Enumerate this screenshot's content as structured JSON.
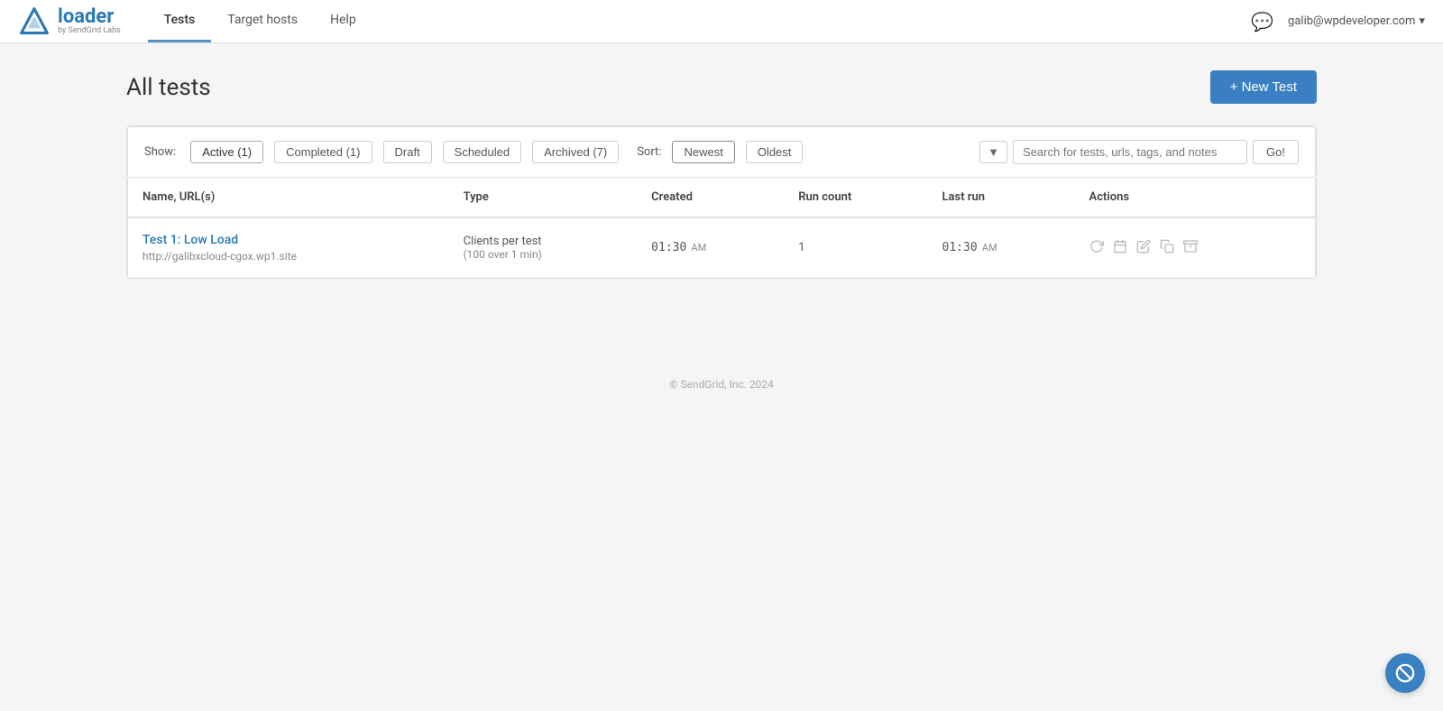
{
  "brand": {
    "name": "loader",
    "sub": "by SendGrid Labs",
    "icon_unicode": "△"
  },
  "nav": {
    "links": [
      {
        "label": "Tests",
        "active": true
      },
      {
        "label": "Target hosts",
        "active": false
      },
      {
        "label": "Help",
        "active": false
      }
    ],
    "user_email": "galib@wpdeveloper.com",
    "user_dropdown_icon": "▾",
    "chat_icon": "💬"
  },
  "page": {
    "title": "All tests",
    "new_test_label": "+ New Test"
  },
  "filter_bar": {
    "show_label": "Show:",
    "filters": [
      {
        "label": "Active (1)",
        "active": true
      },
      {
        "label": "Completed (1)",
        "active": false
      },
      {
        "label": "Draft",
        "active": false
      },
      {
        "label": "Scheduled",
        "active": false
      },
      {
        "label": "Archived (7)",
        "active": false
      }
    ],
    "sort_label": "Sort:",
    "sort_options": [
      {
        "label": "Newest",
        "active": true
      },
      {
        "label": "Oldest",
        "active": false
      }
    ],
    "search_placeholder": "Search for tests, urls, tags, and notes",
    "go_label": "Go!",
    "filter_icon": "▼"
  },
  "table": {
    "columns": [
      {
        "label": "Name, URL(s)"
      },
      {
        "label": "Type"
      },
      {
        "label": "Created"
      },
      {
        "label": "Run count"
      },
      {
        "label": "Last run"
      },
      {
        "label": "Actions"
      }
    ],
    "rows": [
      {
        "name": "Test 1: Low Load",
        "url": "http://galibxcloud-cgox.wp1.site",
        "type_line1": "Clients per test",
        "type_line2": "(100 over 1 min)",
        "created_time": "01:30",
        "created_ampm": "AM",
        "run_count": "1",
        "last_run_time": "01:30",
        "last_run_ampm": "AM"
      }
    ]
  },
  "footer": {
    "text": "© SendGrid, Inc. 2024"
  },
  "actions": {
    "icons": [
      "↺",
      "📅",
      "✎",
      "📄",
      "🗂"
    ]
  }
}
